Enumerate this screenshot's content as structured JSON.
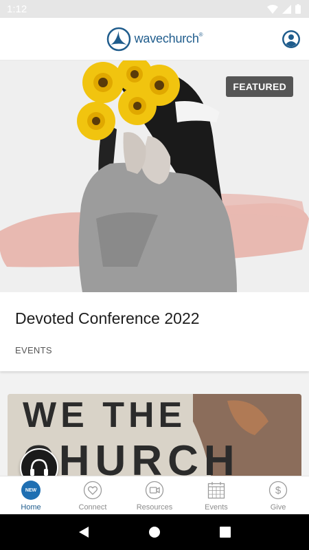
{
  "status_bar": {
    "time": "1:12"
  },
  "header": {
    "logo_text_a": "wave",
    "logo_text_b": "church",
    "logo_reg": "®"
  },
  "featured": {
    "badge": "FEATURED",
    "title": "Devoted Conference 2022",
    "category": "EVENTS"
  },
  "second_card": {
    "line1": "WE THE",
    "line2": "CHURCH"
  },
  "tabs": [
    {
      "label": "Home",
      "icon": "new-badge-icon",
      "badge": "NEW",
      "active": true
    },
    {
      "label": "Connect",
      "icon": "heart-icon",
      "active": false
    },
    {
      "label": "Resources",
      "icon": "video-icon",
      "active": false
    },
    {
      "label": "Events",
      "icon": "calendar-icon",
      "active": false
    },
    {
      "label": "Give",
      "icon": "dollar-icon",
      "active": false
    }
  ],
  "colors": {
    "brand": "#1f5c8c",
    "badge_bg": "#555555",
    "status_bar": "#e6e6e6"
  }
}
